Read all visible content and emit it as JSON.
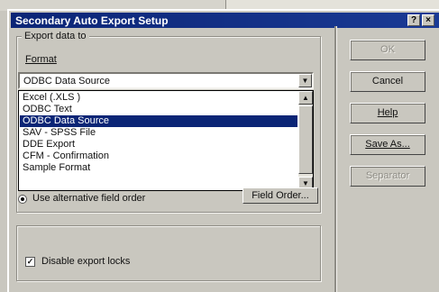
{
  "dialog": {
    "title": "Secondary Auto Export Setup",
    "title_buttons": [
      "?",
      "×"
    ]
  },
  "export_group": {
    "label": "Export data to",
    "format_label": "Format"
  },
  "format_combo": {
    "value": "ODBC Data Source"
  },
  "format_list": {
    "items": [
      "Excel (.XLS )",
      "ODBC Text",
      "ODBC Data Source",
      "SAV - SPSS File",
      "DDE Export",
      "CFM - Confirmation",
      "Sample Format"
    ],
    "selected_index": 2
  },
  "field_order": {
    "radio_label": "Use alternative field order",
    "button_label": "Field Order..."
  },
  "export_locks": {
    "checkbox_label": "Disable export locks",
    "checked": true
  },
  "buttons": {
    "ok": "OK",
    "cancel": "Cancel",
    "help": "Help",
    "save_as": "Save As...",
    "separator": "Separator"
  },
  "colors": {
    "titlebar": "#0b2576",
    "selection": "#0b2576",
    "face": "#c9c7bf"
  }
}
